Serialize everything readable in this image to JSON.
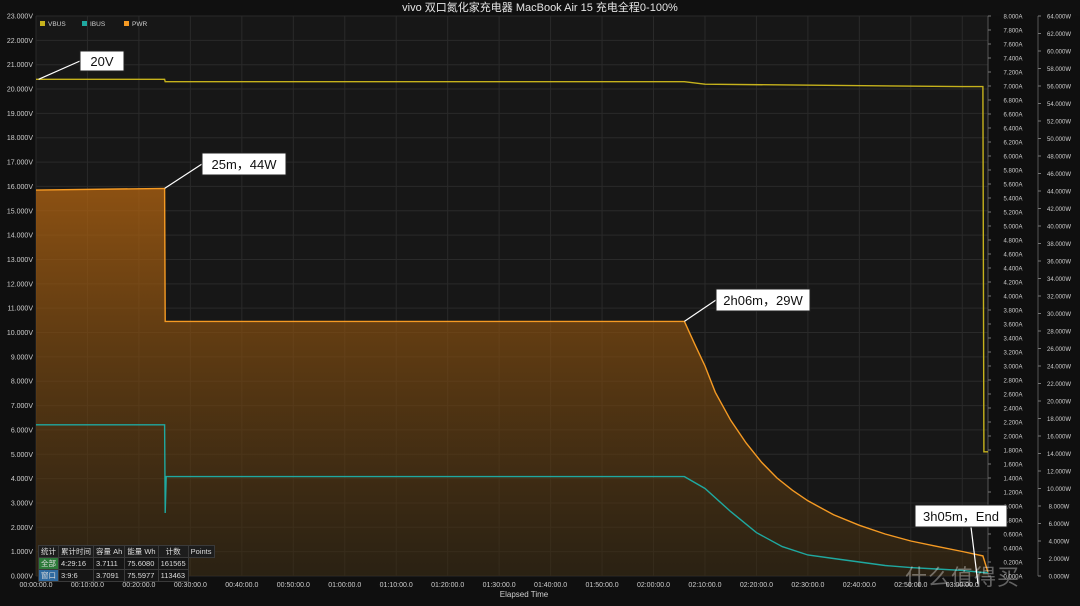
{
  "title": "vivo 双口氮化家充电器 MacBook Air 15 充电全程0-100%",
  "colors": {
    "vbus": "#c6b21c",
    "ibus": "#1fa8a0",
    "pwr": "#f59a23",
    "grid": "#2a2a2a",
    "plot_bg": "#171717"
  },
  "chart_data": {
    "type": "line",
    "title": "vivo 双口氮化家充电器 MacBook Air 15 充电全程0-100%",
    "xlabel": "Elapsed Time",
    "x_unit": "minutes",
    "xlim": [
      0,
      185
    ],
    "x_ticks": [
      "00:00:00.0",
      "00:10:00.0",
      "00:20:00.0",
      "00:30:00.0",
      "00:40:00.0",
      "00:50:00.0",
      "01:00:00.0",
      "01:10:00.0",
      "01:20:00.0",
      "01:30:00.0",
      "01:40:00.0",
      "01:50:00.0",
      "02:00:00.0",
      "02:10:00.0",
      "02:20:00.0",
      "02:30:00.0",
      "02:40:00.0",
      "02:50:00.0",
      "03:00:00.0"
    ],
    "y_left_ticks": [
      "0.000V",
      "1.000V",
      "2.000V",
      "3.000V",
      "4.000V",
      "5.000V",
      "6.000V",
      "7.000V",
      "8.000V",
      "9.000V",
      "10.000V",
      "11.000V",
      "12.000V",
      "13.000V",
      "14.000V",
      "15.000V",
      "16.000V",
      "17.000V",
      "18.000V",
      "19.000V",
      "20.000V",
      "21.000V",
      "22.000V",
      "23.000V"
    ],
    "y_left_lim": [
      0,
      23
    ],
    "y_mid_ticks": [
      "0.000A",
      "0.200A",
      "0.400A",
      "0.600A",
      "0.800A",
      "1.000A",
      "1.200A",
      "1.400A",
      "1.600A",
      "1.800A",
      "2.000A",
      "2.200A",
      "2.400A",
      "2.600A",
      "2.800A",
      "3.000A",
      "3.200A",
      "3.400A",
      "3.600A",
      "3.800A",
      "4.000A",
      "4.200A",
      "4.400A",
      "4.600A",
      "4.800A",
      "5.000A",
      "5.200A",
      "5.400A",
      "5.600A",
      "5.800A",
      "6.000A",
      "6.200A",
      "6.400A",
      "6.600A",
      "6.800A",
      "7.000A",
      "7.200A",
      "7.400A",
      "7.600A",
      "7.800A",
      "8.000A"
    ],
    "y_mid_lim": [
      0,
      8
    ],
    "y_right_ticks": [
      "0.000W",
      "2.000W",
      "4.000W",
      "6.000W",
      "8.000W",
      "10.000W",
      "12.000W",
      "14.000W",
      "16.000W",
      "18.000W",
      "20.000W",
      "22.000W",
      "24.000W",
      "26.000W",
      "28.000W",
      "30.000W",
      "32.000W",
      "34.000W",
      "36.000W",
      "38.000W",
      "40.000W",
      "42.000W",
      "44.000W",
      "46.000W",
      "48.000W",
      "50.000W",
      "52.000W",
      "54.000W",
      "56.000W",
      "58.000W",
      "60.000W",
      "62.000W",
      "64.000W"
    ],
    "y_right_lim": [
      0,
      64
    ],
    "legend_position": "top-left",
    "grid": true,
    "series": [
      {
        "name": "VBUS",
        "unit": "V",
        "x": [
          0,
          25,
          25.1,
          126,
          130,
          180,
          184,
          184.2,
          185
        ],
        "y": [
          20.4,
          20.4,
          20.3,
          20.3,
          20.2,
          20.1,
          20.1,
          5.1,
          5.1
        ]
      },
      {
        "name": "IBUS",
        "unit": "A",
        "x": [
          0,
          25,
          25.1,
          25.3,
          126,
          130,
          135,
          140,
          145,
          150,
          155,
          160,
          165,
          170,
          175,
          180,
          184,
          185
        ],
        "y": [
          2.16,
          2.16,
          0.9,
          1.42,
          1.42,
          1.25,
          0.92,
          0.62,
          0.42,
          0.3,
          0.25,
          0.2,
          0.15,
          0.12,
          0.1,
          0.08,
          0.05,
          0.05
        ]
      },
      {
        "name": "PWR",
        "unit": "W",
        "x": [
          0,
          25,
          25.1,
          126,
          128,
          130,
          132,
          135,
          138,
          141,
          144,
          147,
          150,
          155,
          160,
          165,
          170,
          175,
          180,
          184,
          185
        ],
        "y": [
          44.1,
          44.3,
          29.1,
          29.1,
          26.5,
          24.0,
          21.0,
          17.8,
          15.2,
          13.0,
          11.2,
          9.8,
          8.6,
          7.0,
          5.8,
          4.8,
          4.0,
          3.4,
          2.8,
          2.3,
          0.4
        ]
      }
    ],
    "annotations": [
      {
        "text": "20V",
        "x": 0.5,
        "series": "VBUS"
      },
      {
        "text": "25m，44W",
        "x": 25,
        "series": "PWR"
      },
      {
        "text": "2h06m，29W",
        "x": 126,
        "series": "PWR"
      },
      {
        "text": "3h05m，End",
        "x": 185,
        "series": "PWR"
      }
    ]
  },
  "stats_table": {
    "headers": [
      "统计",
      "累计时间",
      "容量 Ah",
      "能量 Wh",
      "计数",
      "Points"
    ],
    "rows": [
      [
        "全部",
        "4:29:16",
        "3.7111",
        "75.6080",
        "161565"
      ],
      [
        "窗口",
        "3:9:6",
        "3.7091",
        "75.5977",
        "113463"
      ]
    ]
  },
  "watermark": "什么值得买"
}
